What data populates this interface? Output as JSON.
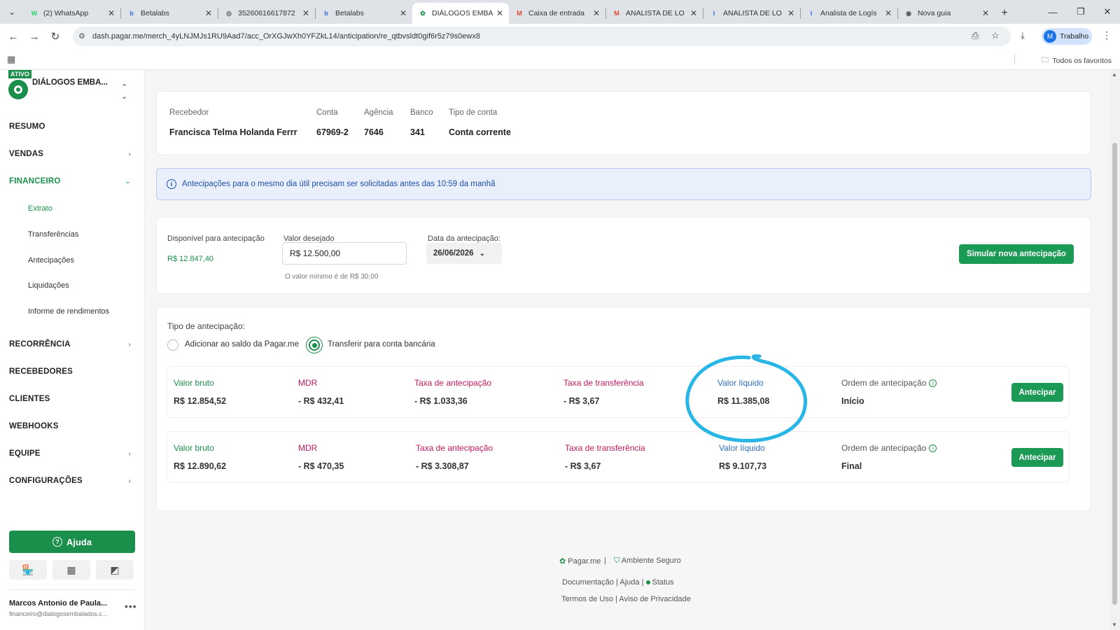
{
  "browser": {
    "tabs": [
      {
        "title": "(2) WhatsApp",
        "icon": "whatsapp-icon",
        "color": "#25d366",
        "glyph": "W"
      },
      {
        "title": "Betalabs",
        "icon": "betalabs-icon",
        "color": "#3b6fd1",
        "glyph": "b"
      },
      {
        "title": "35260616617872",
        "icon": "globe-icon",
        "color": "#555555",
        "glyph": "◎"
      },
      {
        "title": "Betalabs",
        "icon": "betalabs-icon",
        "color": "#3b6fd1",
        "glyph": "b"
      },
      {
        "title": "DIÁLOGOS EMBA",
        "icon": "pagarme-icon",
        "color": "#1a8f4b",
        "glyph": "✿",
        "active": true
      },
      {
        "title": "Caixa de entrada",
        "icon": "gmail-icon",
        "color": "#ea4335",
        "glyph": "M"
      },
      {
        "title": "ANALISTA DE LO",
        "icon": "gmail-icon",
        "color": "#ea4335",
        "glyph": "M"
      },
      {
        "title": "ANALISTA DE LO",
        "icon": "indeed-icon",
        "color": "#2164f3",
        "glyph": "i"
      },
      {
        "title": "Analista de Logís",
        "icon": "indeed-icon",
        "color": "#2164f3",
        "glyph": "i"
      },
      {
        "title": "Nova guia",
        "icon": "chrome-icon",
        "color": "#555555",
        "glyph": "◉"
      }
    ],
    "url": "dash.pagar.me/merch_4yLNJMJs1RU9Aad7/acc_OrXGJwXh0YFZkL14/anticipation/re_qtbvsldt0gif6r5z79s0ewx8",
    "profile_label": "Trabalho",
    "profile_initial": "M",
    "all_bookmarks": "Todos os favoritos"
  },
  "sidebar": {
    "badge": "ATIVO",
    "org_name": "DIÁLOGOS EMBA...",
    "items": [
      {
        "label": "RESUMO",
        "chevron": ""
      },
      {
        "label": "VENDAS",
        "chevron": "›"
      },
      {
        "label": "FINANCEIRO",
        "chevron": "⌄",
        "active": true
      },
      {
        "label": "RECORRÊNCIA",
        "chevron": "›"
      },
      {
        "label": "RECEBEDORES",
        "chevron": ""
      },
      {
        "label": "CLIENTES",
        "chevron": ""
      },
      {
        "label": "WEBHOOKS",
        "chevron": ""
      },
      {
        "label": "EQUIPE",
        "chevron": "›"
      },
      {
        "label": "CONFIGURAÇÕES",
        "chevron": "›"
      }
    ],
    "financeiro_sub": [
      "Extrato",
      "Transferências",
      "Antecipações",
      "Liquidações",
      "Informe de rendimentos"
    ],
    "help_label": "Ajuda",
    "user_name": "Marcos Antonio de Paula...",
    "user_email": "financeiro@dialogosembalados.c..."
  },
  "recipient": {
    "headers": {
      "recebedor": "Recebedor",
      "conta": "Conta",
      "agencia": "Agência",
      "banco": "Banco",
      "tipo": "Tipo de conta"
    },
    "values": {
      "recebedor": "Francisca Telma Holanda Ferrr",
      "conta": "67969-2",
      "agencia": "7646",
      "banco": "341",
      "tipo": "Conta corrente"
    }
  },
  "banner": "Antecipações para o mesmo dia útil precisam ser solicitadas antes das 10:59 da manhã",
  "simulation": {
    "available_label": "Disponível para antecipação",
    "available_value": "R$ 12.847,40",
    "desired_label": "Valor desejado",
    "desired_value": "R$ 12.500,00",
    "min_hint": "O valor mínimo é de R$ 30,00",
    "date_label": "Data da antecipação:",
    "date_value": "26/06/2026",
    "simulate_button": "Simular nova antecipação"
  },
  "anticipation": {
    "type_label": "Tipo de antecipação:",
    "option_balance": "Adicionar ao saldo da Pagar.me",
    "option_transfer": "Transferir para conta bancária",
    "selected": "transfer",
    "column_headers": [
      "Valor bruto",
      "MDR",
      "Taxa de antecipação",
      "Taxa de transferência",
      "Valor líquido",
      "Ordem de antecipação"
    ],
    "rows": [
      {
        "bruto": "R$ 12.854,52",
        "mdr": "- R$ 432,41",
        "taxa_antecipacao": "- R$ 1.033,36",
        "taxa_transferencia": "- R$ 3,67",
        "liquido": "R$ 11.385,08",
        "ordem": "Início",
        "button": "Antecipar"
      },
      {
        "bruto": "R$ 12.890,62",
        "mdr": "- R$ 470,35",
        "taxa_antecipacao": "- R$ 3.308,87",
        "taxa_transferencia": "- R$ 3,67",
        "liquido": "R$ 9.107,73",
        "ordem": "Final",
        "button": "Antecipar"
      }
    ]
  },
  "footer": {
    "brand": "Pagar.me",
    "secure": "Ambiente Seguro",
    "links1": [
      "Documentação",
      "Ajuda",
      "Status"
    ],
    "links2": [
      "Termos de Uso",
      "Aviso de Privacidade"
    ]
  },
  "colors": {
    "brand_green": "#1a8f4b",
    "annotation": "#29b6e6"
  }
}
